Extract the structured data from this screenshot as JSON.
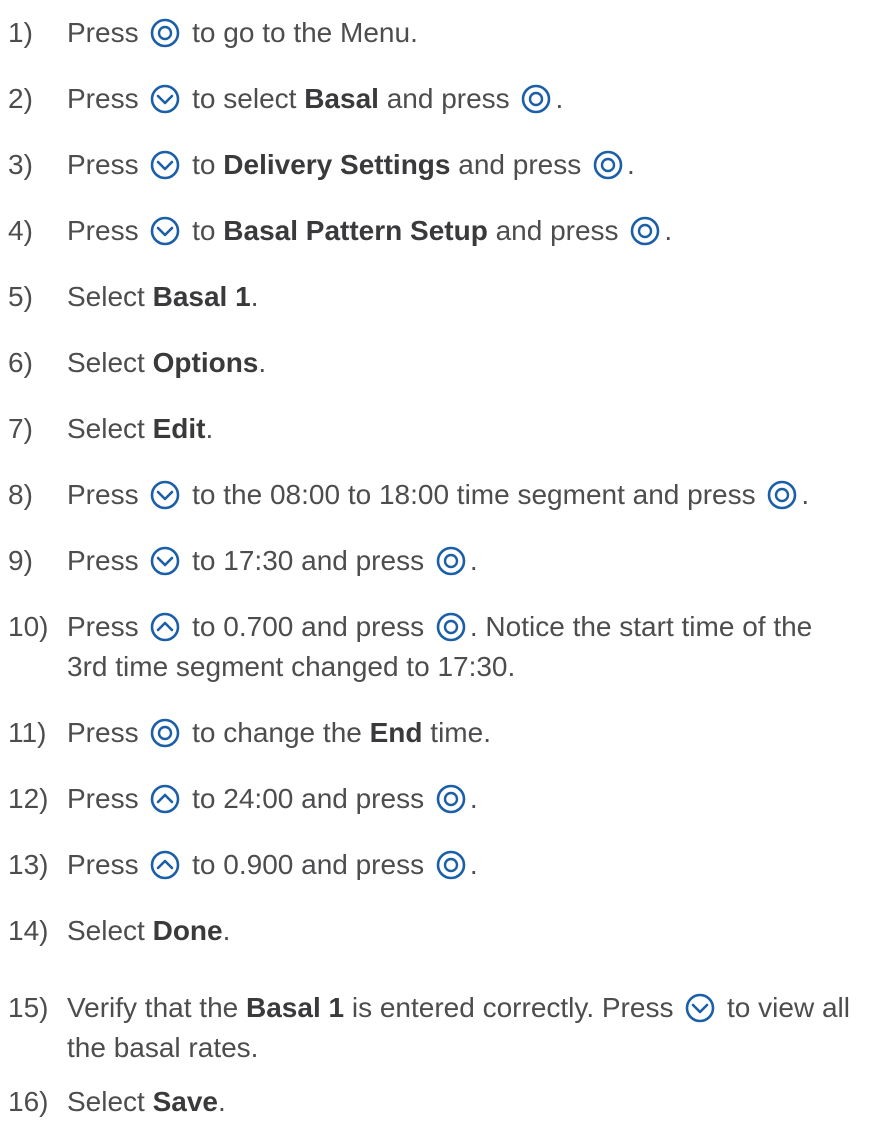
{
  "icon_color": "#1b5fa8",
  "text_color": "#4d4d4f",
  "steps": [
    {
      "num": "1)",
      "parts": [
        {
          "t": "text",
          "v": "Press "
        },
        {
          "t": "icon",
          "v": "select-button-icon"
        },
        {
          "t": "text",
          "v": " to go to the Menu."
        }
      ]
    },
    {
      "num": "2)",
      "parts": [
        {
          "t": "text",
          "v": "Press "
        },
        {
          "t": "icon",
          "v": "down-button-icon"
        },
        {
          "t": "text",
          "v": " to select "
        },
        {
          "t": "bold",
          "v": "Basal"
        },
        {
          "t": "text",
          "v": " and press "
        },
        {
          "t": "icon",
          "v": "select-button-icon"
        },
        {
          "t": "text",
          "v": "."
        }
      ]
    },
    {
      "num": "3)",
      "parts": [
        {
          "t": "text",
          "v": "Press "
        },
        {
          "t": "icon",
          "v": "down-button-icon"
        },
        {
          "t": "text",
          "v": " to "
        },
        {
          "t": "bold",
          "v": "Delivery Settings"
        },
        {
          "t": "text",
          "v": " and press "
        },
        {
          "t": "icon",
          "v": "select-button-icon"
        },
        {
          "t": "text",
          "v": "."
        }
      ]
    },
    {
      "num": "4)",
      "parts": [
        {
          "t": "text",
          "v": "Press "
        },
        {
          "t": "icon",
          "v": "down-button-icon"
        },
        {
          "t": "text",
          "v": " to "
        },
        {
          "t": "bold",
          "v": "Basal Pattern Setup"
        },
        {
          "t": "text",
          "v": " and press "
        },
        {
          "t": "icon",
          "v": "select-button-icon"
        },
        {
          "t": "text",
          "v": "."
        }
      ]
    },
    {
      "num": "5)",
      "parts": [
        {
          "t": "text",
          "v": "Select "
        },
        {
          "t": "bold",
          "v": "Basal 1"
        },
        {
          "t": "text",
          "v": "."
        }
      ]
    },
    {
      "num": "6)",
      "parts": [
        {
          "t": "text",
          "v": "Select "
        },
        {
          "t": "bold",
          "v": "Options"
        },
        {
          "t": "text",
          "v": "."
        }
      ]
    },
    {
      "num": "7)",
      "parts": [
        {
          "t": "text",
          "v": "Select "
        },
        {
          "t": "bold",
          "v": "Edit"
        },
        {
          "t": "text",
          "v": "."
        }
      ]
    },
    {
      "num": "8)",
      "parts": [
        {
          "t": "text",
          "v": "Press "
        },
        {
          "t": "icon",
          "v": "down-button-icon"
        },
        {
          "t": "text",
          "v": " to the 08:00 to 18:00 time segment and press "
        },
        {
          "t": "icon",
          "v": "select-button-icon"
        },
        {
          "t": "text",
          "v": "."
        }
      ]
    },
    {
      "num": "9)",
      "parts": [
        {
          "t": "text",
          "v": "Press "
        },
        {
          "t": "icon",
          "v": "down-button-icon"
        },
        {
          "t": "text",
          "v": " to 17:30 and press "
        },
        {
          "t": "icon",
          "v": "select-button-icon"
        },
        {
          "t": "text",
          "v": "."
        }
      ]
    },
    {
      "num": "10)",
      "parts": [
        {
          "t": "text",
          "v": "Press "
        },
        {
          "t": "icon",
          "v": "up-button-icon"
        },
        {
          "t": "text",
          "v": " to 0.700 and press "
        },
        {
          "t": "icon",
          "v": "select-button-icon"
        },
        {
          "t": "text",
          "v": ". Notice the start time of the 3rd time segment changed to 17:30."
        }
      ]
    },
    {
      "num": "11)",
      "parts": [
        {
          "t": "text",
          "v": "Press "
        },
        {
          "t": "icon",
          "v": "select-button-icon"
        },
        {
          "t": "text",
          "v": " to change the "
        },
        {
          "t": "bold",
          "v": "End"
        },
        {
          "t": "text",
          "v": " time."
        }
      ]
    },
    {
      "num": "12)",
      "parts": [
        {
          "t": "text",
          "v": "Press "
        },
        {
          "t": "icon",
          "v": "up-button-icon"
        },
        {
          "t": "text",
          "v": " to 24:00 and press "
        },
        {
          "t": "icon",
          "v": "select-button-icon"
        },
        {
          "t": "text",
          "v": "."
        }
      ]
    },
    {
      "num": "13)",
      "parts": [
        {
          "t": "text",
          "v": "Press "
        },
        {
          "t": "icon",
          "v": "up-button-icon"
        },
        {
          "t": "text",
          "v": " to 0.900 and press "
        },
        {
          "t": "icon",
          "v": "select-button-icon"
        },
        {
          "t": "text",
          "v": "."
        }
      ]
    },
    {
      "num": "14)",
      "parts": [
        {
          "t": "text",
          "v": "Select "
        },
        {
          "t": "bold",
          "v": "Done"
        },
        {
          "t": "text",
          "v": "."
        }
      ]
    },
    {
      "num": "15)",
      "parts": [
        {
          "t": "text",
          "v": "Verify that the "
        },
        {
          "t": "bold",
          "v": "Basal 1"
        },
        {
          "t": "text",
          "v": " is entered correctly. Press "
        },
        {
          "t": "icon",
          "v": "down-button-icon"
        },
        {
          "t": "text",
          "v": " to view all the basal rates."
        }
      ]
    },
    {
      "num": "16)",
      "parts": [
        {
          "t": "text",
          "v": "Select "
        },
        {
          "t": "bold",
          "v": "Save"
        },
        {
          "t": "text",
          "v": "."
        }
      ]
    }
  ]
}
